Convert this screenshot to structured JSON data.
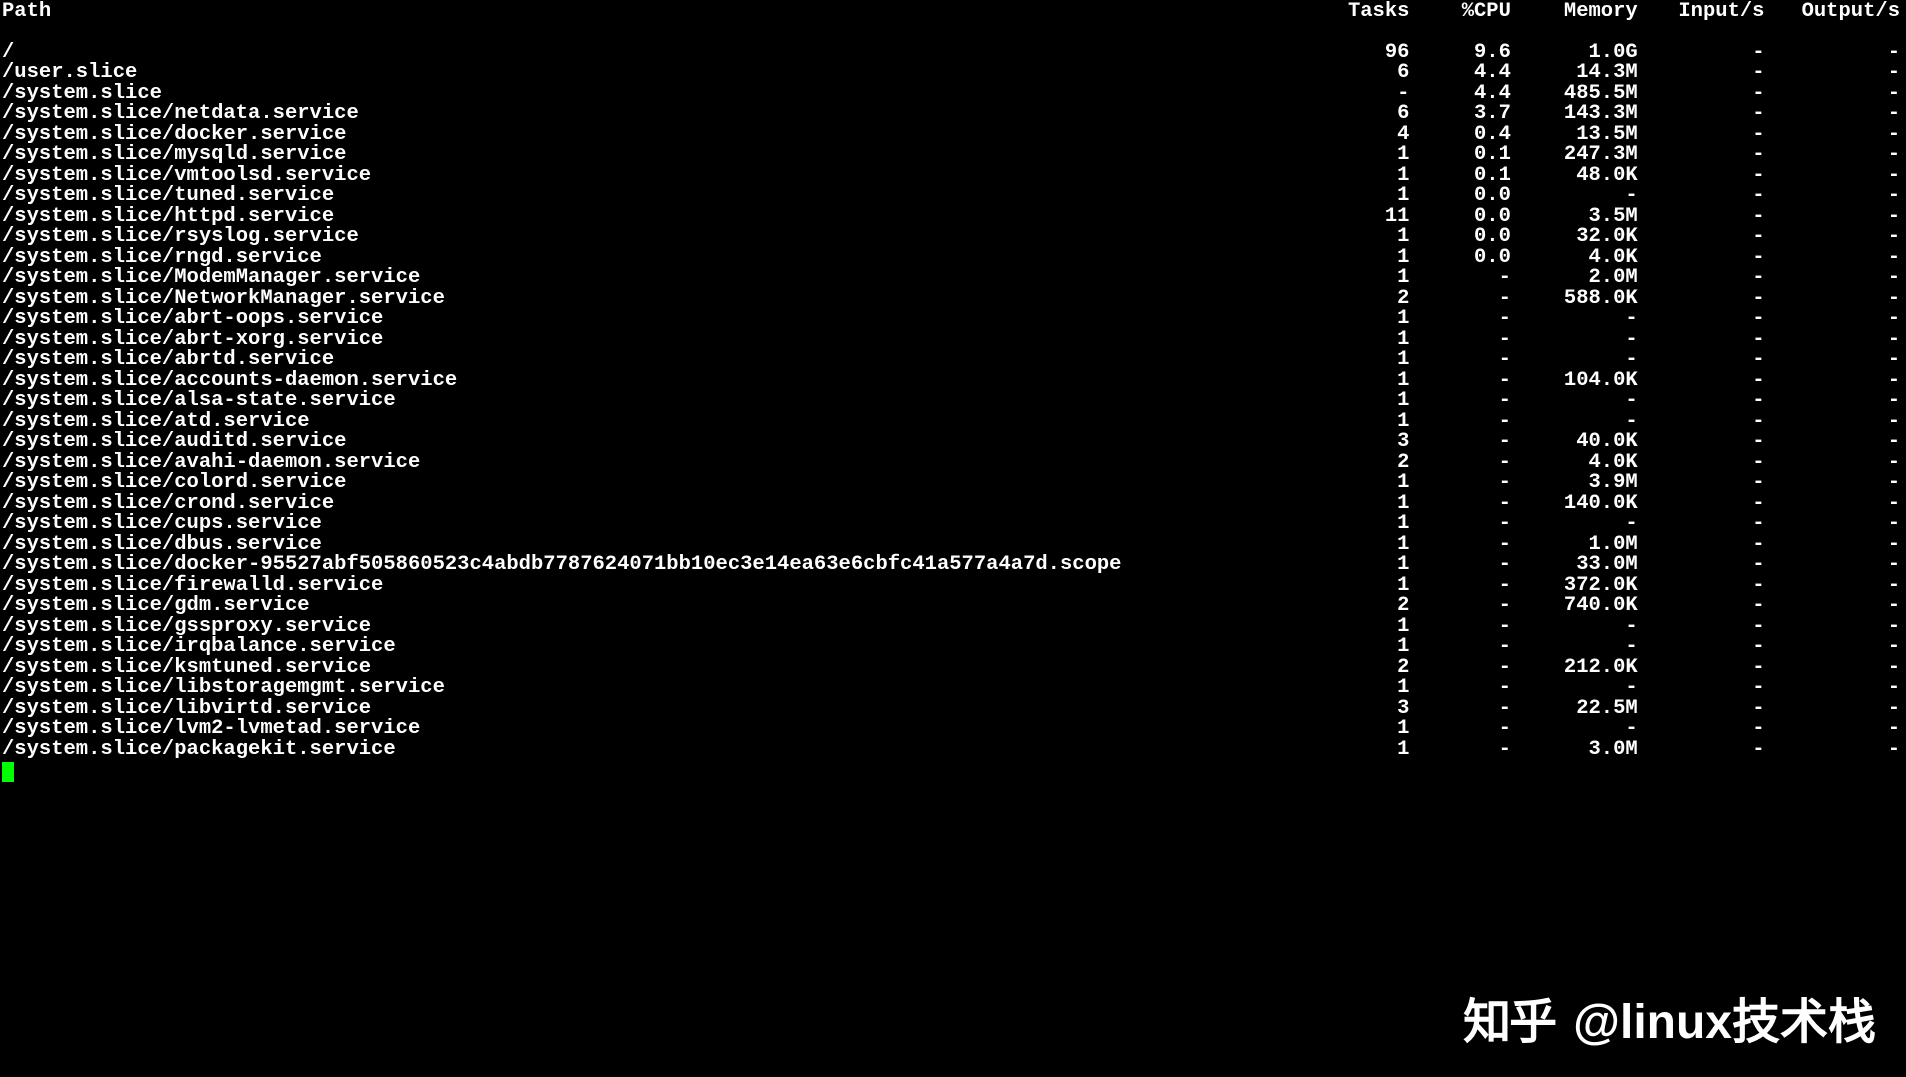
{
  "headers": {
    "path": "Path",
    "tasks": "Tasks",
    "cpu": "%CPU",
    "memory": "Memory",
    "input": "Input/s",
    "output": "Output/s"
  },
  "rows": [
    {
      "path": "/",
      "tasks": "96",
      "cpu": "9.6",
      "memory": "1.0G",
      "input": "-",
      "output": "-"
    },
    {
      "path": "/user.slice",
      "tasks": "6",
      "cpu": "4.4",
      "memory": "14.3M",
      "input": "-",
      "output": "-"
    },
    {
      "path": "/system.slice",
      "tasks": "-",
      "cpu": "4.4",
      "memory": "485.5M",
      "input": "-",
      "output": "-"
    },
    {
      "path": "/system.slice/netdata.service",
      "tasks": "6",
      "cpu": "3.7",
      "memory": "143.3M",
      "input": "-",
      "output": "-"
    },
    {
      "path": "/system.slice/docker.service",
      "tasks": "4",
      "cpu": "0.4",
      "memory": "13.5M",
      "input": "-",
      "output": "-"
    },
    {
      "path": "/system.slice/mysqld.service",
      "tasks": "1",
      "cpu": "0.1",
      "memory": "247.3M",
      "input": "-",
      "output": "-"
    },
    {
      "path": "/system.slice/vmtoolsd.service",
      "tasks": "1",
      "cpu": "0.1",
      "memory": "48.0K",
      "input": "-",
      "output": "-"
    },
    {
      "path": "/system.slice/tuned.service",
      "tasks": "1",
      "cpu": "0.0",
      "memory": "-",
      "input": "-",
      "output": "-"
    },
    {
      "path": "/system.slice/httpd.service",
      "tasks": "11",
      "cpu": "0.0",
      "memory": "3.5M",
      "input": "-",
      "output": "-"
    },
    {
      "path": "/system.slice/rsyslog.service",
      "tasks": "1",
      "cpu": "0.0",
      "memory": "32.0K",
      "input": "-",
      "output": "-"
    },
    {
      "path": "/system.slice/rngd.service",
      "tasks": "1",
      "cpu": "0.0",
      "memory": "4.0K",
      "input": "-",
      "output": "-"
    },
    {
      "path": "/system.slice/ModemManager.service",
      "tasks": "1",
      "cpu": "-",
      "memory": "2.0M",
      "input": "-",
      "output": "-"
    },
    {
      "path": "/system.slice/NetworkManager.service",
      "tasks": "2",
      "cpu": "-",
      "memory": "588.0K",
      "input": "-",
      "output": "-"
    },
    {
      "path": "/system.slice/abrt-oops.service",
      "tasks": "1",
      "cpu": "-",
      "memory": "-",
      "input": "-",
      "output": "-"
    },
    {
      "path": "/system.slice/abrt-xorg.service",
      "tasks": "1",
      "cpu": "-",
      "memory": "-",
      "input": "-",
      "output": "-"
    },
    {
      "path": "/system.slice/abrtd.service",
      "tasks": "1",
      "cpu": "-",
      "memory": "-",
      "input": "-",
      "output": "-"
    },
    {
      "path": "/system.slice/accounts-daemon.service",
      "tasks": "1",
      "cpu": "-",
      "memory": "104.0K",
      "input": "-",
      "output": "-"
    },
    {
      "path": "/system.slice/alsa-state.service",
      "tasks": "1",
      "cpu": "-",
      "memory": "-",
      "input": "-",
      "output": "-"
    },
    {
      "path": "/system.slice/atd.service",
      "tasks": "1",
      "cpu": "-",
      "memory": "-",
      "input": "-",
      "output": "-"
    },
    {
      "path": "/system.slice/auditd.service",
      "tasks": "3",
      "cpu": "-",
      "memory": "40.0K",
      "input": "-",
      "output": "-"
    },
    {
      "path": "/system.slice/avahi-daemon.service",
      "tasks": "2",
      "cpu": "-",
      "memory": "4.0K",
      "input": "-",
      "output": "-"
    },
    {
      "path": "/system.slice/colord.service",
      "tasks": "1",
      "cpu": "-",
      "memory": "3.9M",
      "input": "-",
      "output": "-"
    },
    {
      "path": "/system.slice/crond.service",
      "tasks": "1",
      "cpu": "-",
      "memory": "140.0K",
      "input": "-",
      "output": "-"
    },
    {
      "path": "/system.slice/cups.service",
      "tasks": "1",
      "cpu": "-",
      "memory": "-",
      "input": "-",
      "output": "-"
    },
    {
      "path": "/system.slice/dbus.service",
      "tasks": "1",
      "cpu": "-",
      "memory": "1.0M",
      "input": "-",
      "output": "-"
    },
    {
      "path": "/system.slice/docker-95527abf505860523c4abdb7787624071bb10ec3e14ea63e6cbfc41a577a4a7d.scope",
      "tasks": "1",
      "cpu": "-",
      "memory": "33.0M",
      "input": "-",
      "output": "-"
    },
    {
      "path": "/system.slice/firewalld.service",
      "tasks": "1",
      "cpu": "-",
      "memory": "372.0K",
      "input": "-",
      "output": "-"
    },
    {
      "path": "/system.slice/gdm.service",
      "tasks": "2",
      "cpu": "-",
      "memory": "740.0K",
      "input": "-",
      "output": "-"
    },
    {
      "path": "/system.slice/gssproxy.service",
      "tasks": "1",
      "cpu": "-",
      "memory": "-",
      "input": "-",
      "output": "-"
    },
    {
      "path": "/system.slice/irqbalance.service",
      "tasks": "1",
      "cpu": "-",
      "memory": "-",
      "input": "-",
      "output": "-"
    },
    {
      "path": "/system.slice/ksmtuned.service",
      "tasks": "2",
      "cpu": "-",
      "memory": "212.0K",
      "input": "-",
      "output": "-"
    },
    {
      "path": "/system.slice/libstoragemgmt.service",
      "tasks": "1",
      "cpu": "-",
      "memory": "-",
      "input": "-",
      "output": "-"
    },
    {
      "path": "/system.slice/libvirtd.service",
      "tasks": "3",
      "cpu": "-",
      "memory": "22.5M",
      "input": "-",
      "output": "-"
    },
    {
      "path": "/system.slice/lvm2-lvmetad.service",
      "tasks": "1",
      "cpu": "-",
      "memory": "-",
      "input": "-",
      "output": "-"
    },
    {
      "path": "/system.slice/packagekit.service",
      "tasks": "1",
      "cpu": "-",
      "memory": "3.0M",
      "input": "-",
      "output": "-"
    }
  ],
  "watermark": {
    "zhihu": "知乎",
    "text": "@linux技术栈"
  }
}
